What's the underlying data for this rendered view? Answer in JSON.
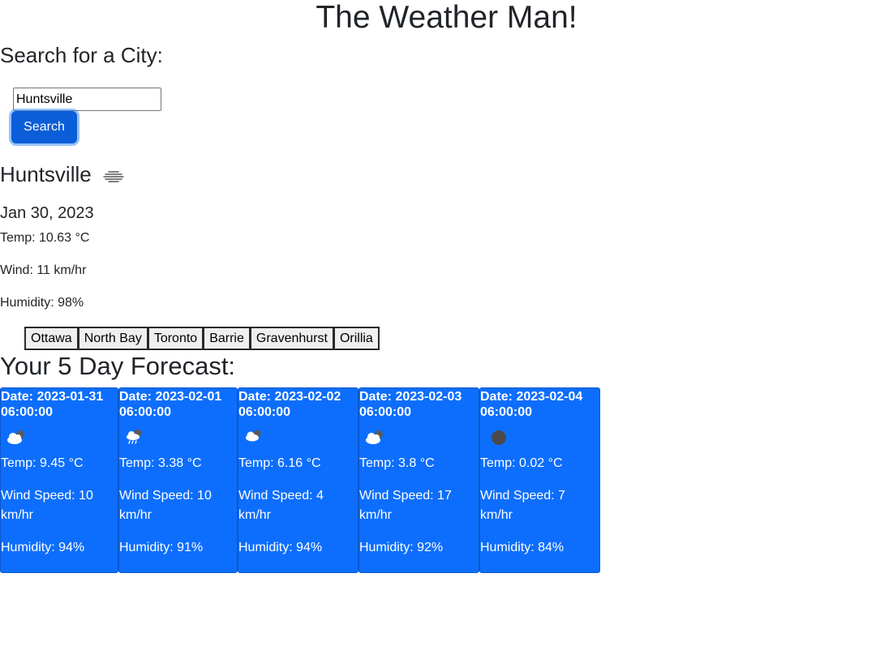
{
  "app": {
    "title": "The Weather Man!"
  },
  "search": {
    "heading": "Search for a City:",
    "input_value": "Huntsville",
    "button_label": "Search"
  },
  "current": {
    "city": "Huntsville",
    "icon": "mist-icon",
    "date": "Jan 30, 2023",
    "temp": "Temp: 10.63 °C",
    "wind": "Wind: 11 km/hr",
    "humidity": "Humidity: 98%"
  },
  "history": {
    "cities": [
      "Ottawa",
      "North Bay",
      "Toronto",
      "Barrie",
      "Gravenhurst",
      "Orillia"
    ]
  },
  "forecast": {
    "heading": "Your 5 Day Forecast:",
    "days": [
      {
        "date": "Date: 2023-01-31 06:00:00",
        "icon": "cloud-icon",
        "temp": "Temp: 9.45 °C",
        "wind": "Wind Speed: 10 km/hr",
        "humidity": "Humidity: 94%"
      },
      {
        "date": "Date: 2023-02-01 06:00:00",
        "icon": "rain-cloud-icon",
        "temp": "Temp: 3.38 °C",
        "wind": "Wind Speed: 10 km/hr",
        "humidity": "Humidity: 91%"
      },
      {
        "date": "Date: 2023-02-02 06:00:00",
        "icon": "cloud-icon",
        "temp": "Temp: 6.16 °C",
        "wind": "Wind Speed: 4 km/hr",
        "humidity": "Humidity: 94%"
      },
      {
        "date": "Date: 2023-02-03 06:00:00",
        "icon": "cloud-icon",
        "temp": "Temp: 3.8 °C",
        "wind": "Wind Speed: 17 km/hr",
        "humidity": "Humidity: 92%"
      },
      {
        "date": "Date: 2023-02-04 06:00:00",
        "icon": "dark-cloud-icon",
        "temp": "Temp: 0.02 °C",
        "wind": "Wind Speed: 7 km/hr",
        "humidity": "Humidity: 84%"
      }
    ]
  },
  "colors": {
    "card_bg": "#0d6efd",
    "button_bg": "#0b5ed7",
    "text": "#212529"
  }
}
